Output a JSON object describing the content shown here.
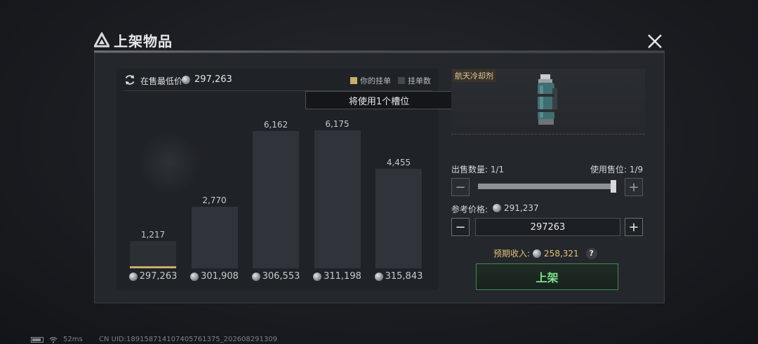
{
  "dialog": {
    "title": "上架物品"
  },
  "chart_header": {
    "lowest_label": "在售最低价",
    "lowest_value": "297,263",
    "legend_mine": "你的挂单",
    "legend_count": "挂单数"
  },
  "tooltip": "将使用1个槽位",
  "chart_data": {
    "type": "bar",
    "categories": [
      "297,263",
      "301,908",
      "306,553",
      "311,198",
      "315,843"
    ],
    "values": [
      1217,
      2770,
      6162,
      6175,
      4455
    ],
    "value_labels": [
      "1,217",
      "2,770",
      "6,162",
      "6,175",
      "4,455"
    ],
    "ylim": [
      0,
      7000
    ],
    "mine_index": 0,
    "colors": {
      "bar": "#30343a",
      "mine": "#c9ad6a"
    }
  },
  "item": {
    "name": "航天冷却剂"
  },
  "sell": {
    "quantity_label": "出售数量: 1/1",
    "slot_label": "使用售位: 1/9",
    "quantity_fraction": 1.0,
    "ref_price_label": "参考价格:",
    "ref_price_value": "291,237",
    "price_input": "297263",
    "income_label": "预期收入:",
    "income_value": "258,321",
    "help": "?",
    "list_button": "上架"
  },
  "footer": {
    "ping": "52ms",
    "uid": "CN UID:18915871410740576137​5_202608291309"
  },
  "colors": {
    "accent_gold": "#c9ad6a",
    "confirm_green": "#7ee08f",
    "income_gold": "#e4c27a"
  }
}
